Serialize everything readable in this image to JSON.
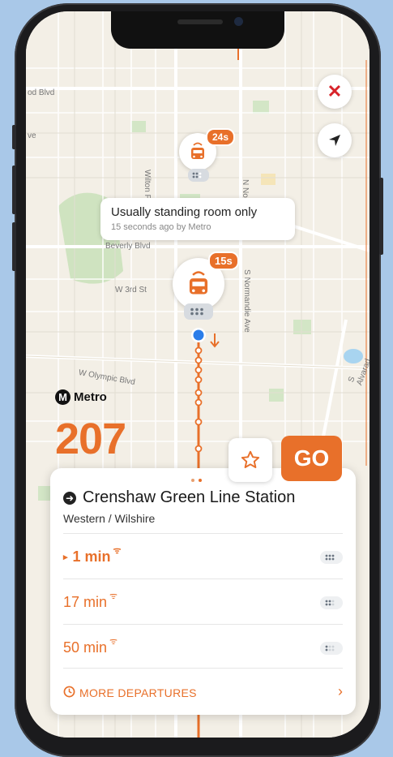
{
  "map": {
    "streets": [
      "od Blvd",
      "ve",
      "Wilton Pl",
      "N Norm",
      "Beverly Blvd",
      "W 3rd St",
      "S Normandie Ave",
      "W Olympic Blvd",
      "S Alvarad"
    ]
  },
  "buses": [
    {
      "eta": "24s"
    },
    {
      "eta": "15s"
    }
  ],
  "tooltip": {
    "title": "Usually standing room only",
    "subtitle": "15 seconds ago by Metro"
  },
  "agency": {
    "logo_letter": "M",
    "name": "Metro"
  },
  "route": {
    "number": "207"
  },
  "actions": {
    "go_label": "GO"
  },
  "stop": {
    "name": "Crenshaw Green Line Station",
    "cross": "Western / Wilshire"
  },
  "departures": [
    {
      "time": "1 min",
      "prefix": "▸"
    },
    {
      "time": "17 min",
      "prefix": ""
    },
    {
      "time": "50 min",
      "prefix": ""
    }
  ],
  "more": {
    "label": "MORE DEPARTURES"
  },
  "colors": {
    "accent": "#e8702a",
    "close": "#d8232a",
    "location": "#2b7de9"
  },
  "icons": [
    "close-icon",
    "location-arrow-icon",
    "bus-icon",
    "realtime-signal-icon",
    "occupancy-icon",
    "star-icon",
    "arrow-right-icon",
    "clock-icon",
    "chevron-right-icon"
  ]
}
